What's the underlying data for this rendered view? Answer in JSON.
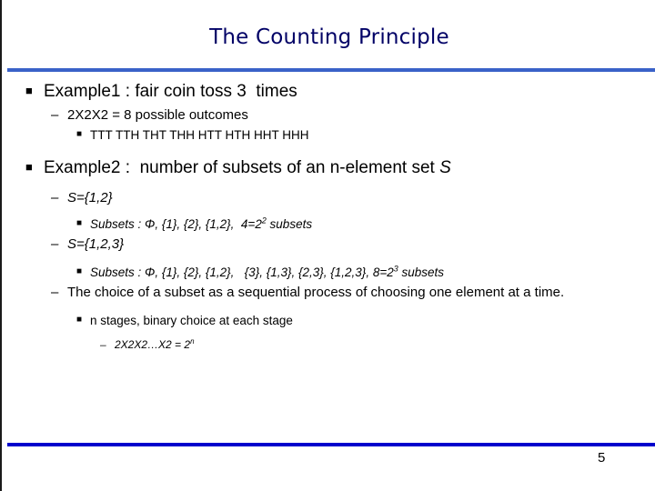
{
  "slide": {
    "title": "The Counting Principle",
    "page_number": "5",
    "accent_top_rule_color": "#3a62c8",
    "accent_bottom_rule_color": "#0000cc",
    "title_color": "#000066",
    "body_text_color": "#000000",
    "background_color": "#ffffff"
  },
  "bullets": {
    "square_glyph": "■",
    "dash_glyph": "–"
  },
  "content": [
    {
      "level": 1,
      "text": "Example1 : fair coin toss 3  times"
    },
    {
      "level": 2,
      "text": "2X2X2 = 8 possible outcomes"
    },
    {
      "level": 3,
      "text": "TTT TTH THT THH HTT HTH HHT HHH"
    },
    {
      "level": 1,
      "text_plain": "Example2 :  number of subsets of an n-element set ",
      "text_italic": "S"
    },
    {
      "level": 2,
      "text": "S={1,2}"
    },
    {
      "level": 3,
      "text_a": "Subsets : Φ, {1}, {2}, {1,2},  4=2",
      "sup": "2",
      "text_b": " subsets"
    },
    {
      "level": 2,
      "text": "S={1,2,3}"
    },
    {
      "level": 3,
      "text_a": "Subsets : Φ, {1}, {2}, {1,2},   {3}, {1,3}, {2,3}, {1,2,3}, 8=2",
      "sup": "3",
      "text_b": " subsets"
    },
    {
      "level": 2,
      "text": "The choice of a subset as a sequential process of choosing one element at a time."
    },
    {
      "level": 3,
      "text": "n stages, binary choice at each stage"
    },
    {
      "level": 4,
      "text_a": "2X2X2…X2 = 2",
      "sup": "n",
      "text_b": ""
    }
  ]
}
